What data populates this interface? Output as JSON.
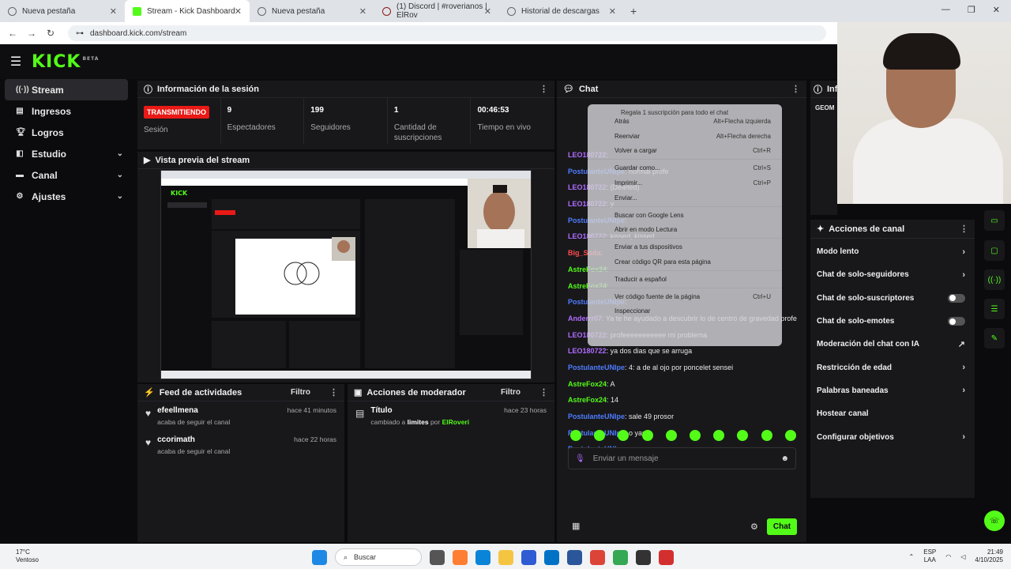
{
  "browser": {
    "tabs": [
      {
        "label": "Nueva pestaña",
        "icon": "globe-icon"
      },
      {
        "label": "Stream - Kick Dashboard",
        "icon": "kick-icon"
      },
      {
        "label": "Nueva pestaña",
        "icon": "globe-icon"
      },
      {
        "label": "(1) Discord | #roverianos | ElRov",
        "icon": "discord-icon"
      },
      {
        "label": "Historial de descargas",
        "icon": "download-icon"
      }
    ],
    "url": "dashboard.kick.com/stream"
  },
  "app": {
    "logo": "KICK",
    "logo_sup": "BETA",
    "sidebar": [
      {
        "label": "Stream",
        "icon": "stream-icon",
        "active": true,
        "chevron": false
      },
      {
        "label": "Ingresos",
        "icon": "money-icon",
        "chevron": false
      },
      {
        "label": "Logros",
        "icon": "trophy-icon",
        "chevron": false
      },
      {
        "label": "Estudio",
        "icon": "studio-icon",
        "chevron": true
      },
      {
        "label": "Canal",
        "icon": "channel-icon",
        "chevron": true
      },
      {
        "label": "Ajustes",
        "icon": "settings-icon",
        "chevron": true
      }
    ]
  },
  "session": {
    "title": "Información de la sesión",
    "status": "TRANSMITIENDO",
    "status_label": "Sesión",
    "stats": [
      {
        "value": "9",
        "label": "Espectadores"
      },
      {
        "value": "199",
        "label": "Seguidores"
      },
      {
        "value": "1",
        "label": "Cantidad de suscripciones"
      },
      {
        "value": "00:46:53",
        "label": "Tiempo en vivo"
      }
    ]
  },
  "preview": {
    "title": "Vista previa del stream"
  },
  "activity": {
    "title": "Feed de actividades",
    "filter": "Filtro",
    "items": [
      {
        "name": "efeellmena",
        "desc": "acaba de seguir el canal",
        "time": "hace 41 minutos"
      },
      {
        "name": "ccorimath",
        "desc": "acaba de seguir el canal",
        "time": "hace 22 horas"
      }
    ]
  },
  "modactions": {
    "title": "Acciones de moderador",
    "filter": "Filtro",
    "items": [
      {
        "name": "Título",
        "desc_pre": "cambiado a ",
        "desc_bold": "limites",
        "desc_mid": " por ",
        "desc_user": "ElRoveri",
        "time": "hace 23 horas"
      }
    ]
  },
  "chat": {
    "title": "Chat",
    "messages": [
      {
        "user": "LEO180722",
        "cls": "u1",
        "text": ""
      },
      {
        "user": "PostulanteUNIpe",
        "cls": "u2",
        "text": "normal profe"
      },
      {
        "user": "LEO180722",
        "cls": "u1",
        "text": "(Deleted)"
      },
      {
        "user": "LEO180722",
        "cls": "u1",
        "text": "y"
      },
      {
        "user": "PostulanteUNIpe",
        "cls": "u2",
        "text": ""
      },
      {
        "user": "LEO180722",
        "cls": "u1",
        "text": "kissed, kissed"
      },
      {
        "user": "Big_Soda",
        "cls": "u4",
        "text": ""
      },
      {
        "user": "AstreFox24",
        "cls": "u3",
        "text": ""
      },
      {
        "user": "AstreFox24",
        "cls": "u3",
        "text": ""
      },
      {
        "user": "PostulanteUNIpe",
        "cls": "u2",
        "text": ""
      },
      {
        "user": "Anderrr07",
        "cls": "u1",
        "text": "Ya te he ayudado a descubrir lo de centro de gravedad profe"
      },
      {
        "user": "LEO180722",
        "cls": "u1",
        "text": "profeeeeeeeeeee mi problema"
      },
      {
        "user": "LEO180722",
        "cls": "u1",
        "text": "ya dos dias que se arruga"
      },
      {
        "user": "PostulanteUNIpe",
        "cls": "u2",
        "text": "4: a de al ojo por poncelet sensei"
      },
      {
        "user": "AstreFox24",
        "cls": "u3",
        "text": "A"
      },
      {
        "user": "AstreFox24",
        "cls": "u3",
        "text": "14"
      },
      {
        "user": "PostulanteUNIpe",
        "cls": "u2",
        "text": "sale 49 prosor"
      },
      {
        "user": "PostulanteUNIpe",
        "cls": "u2",
        "text": "o yara"
      },
      {
        "user": "PostulanteUNIpe",
        "cls": "u2",
        "text": ""
      }
    ],
    "input_placeholder": "Enviar un mensaje",
    "send_label": "Chat"
  },
  "context_menu": {
    "items": [
      {
        "label": "Atrás",
        "shortcut": "Alt+Flecha izquierda"
      },
      {
        "label": "Reenviar",
        "shortcut": "Alt+Flecha derecha"
      },
      {
        "label": "Volver a cargar",
        "shortcut": "Ctrl+R"
      },
      {
        "sep": true
      },
      {
        "label": "Guardar como...",
        "shortcut": "Ctrl+S"
      },
      {
        "label": "Imprimir...",
        "shortcut": "Ctrl+P"
      },
      {
        "label": "Enviar...",
        "shortcut": ""
      },
      {
        "sep": true
      },
      {
        "label": "Buscar con Google Lens",
        "shortcut": ""
      },
      {
        "label": "Abrir en modo Lectura",
        "shortcut": ""
      },
      {
        "sep": true
      },
      {
        "label": "Enviar a tus dispositivos",
        "shortcut": ""
      },
      {
        "label": "Crear código QR para esta página",
        "shortcut": ""
      },
      {
        "sep": true
      },
      {
        "label": "Traducir a español",
        "shortcut": ""
      },
      {
        "sep": true
      },
      {
        "label": "Ver código fuente de la página",
        "shortcut": "Ctrl+U"
      },
      {
        "label": "Inspeccionar",
        "shortcut": ""
      }
    ],
    "header": "Regala 1 suscripción para todo el chat"
  },
  "channel_actions": {
    "info_title": "Info",
    "info_name": "GEOM",
    "title": "Acciones de canal",
    "items": [
      {
        "label": "Modo lento",
        "type": "chevron"
      },
      {
        "label": "Chat de solo-seguidores",
        "type": "chevron"
      },
      {
        "label": "Chat de solo-suscriptores",
        "type": "toggle"
      },
      {
        "label": "Chat de solo-emotes",
        "type": "toggle"
      },
      {
        "label": "Moderación del chat con IA",
        "type": "external"
      },
      {
        "label": "Restricción de edad",
        "type": "chevron"
      },
      {
        "label": "Palabras baneadas",
        "type": "chevron"
      },
      {
        "label": "Hostear canal",
        "type": "none"
      },
      {
        "label": "Configurar objetivos",
        "type": "chevron"
      }
    ]
  },
  "taskbar": {
    "weather_temp": "17°C",
    "weather_desc": "Ventoso",
    "search_placeholder": "Buscar",
    "lang": "ESP",
    "lang2": "LAA",
    "time": "21:49",
    "date": "4/10/2025"
  },
  "colors": {
    "accent": "#53fc18",
    "live": "#e91916",
    "panel": "#18181b",
    "bg": "#0b0b0d"
  }
}
